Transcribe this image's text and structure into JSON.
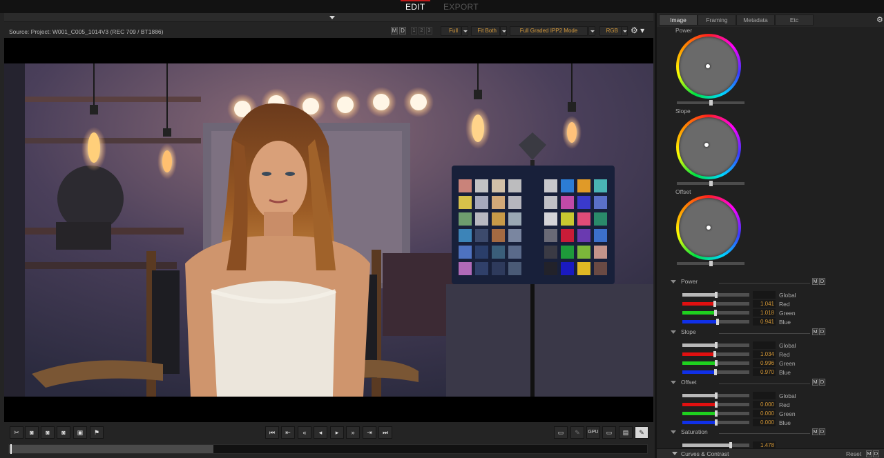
{
  "modes": {
    "edit": "EDIT",
    "export": "EXPORT"
  },
  "viewer": {
    "source_label": "Source: Project: W001_C005_1014V3     (REC 709 / BT1886)",
    "buttons": {
      "m": "M",
      "d": "D",
      "one": "1",
      "two": "2",
      "three": "3"
    },
    "dropdowns": {
      "resolution": "Full",
      "fit": "Fit Both",
      "mode": "Full Graded IPP2 Mode",
      "channel": "RGB"
    },
    "gear": "⚙"
  },
  "transport": {
    "left_tools": [
      "✂",
      "◙",
      "◙",
      "◙",
      "▣",
      "⚑"
    ],
    "playback": [
      "⏮",
      "⇤",
      "«",
      "◂",
      "▸",
      "»",
      "⇥",
      "⏭"
    ],
    "right_tools": [
      "▭",
      "✎",
      "GPU",
      "▭",
      "▤",
      "✎"
    ]
  },
  "timeline": {
    "progress": 0.32
  },
  "panel": {
    "tabs": [
      "Image",
      "Framing",
      "Metadata",
      "Etc"
    ],
    "active_tab": "Image",
    "gear": "⚙",
    "wheels": [
      {
        "label": "Power",
        "dot_x": 0.49,
        "dot_y": 0.5,
        "slider": 0.5
      },
      {
        "label": "Slope",
        "dot_x": 0.47,
        "dot_y": 0.46,
        "slider": 0.5
      },
      {
        "label": "Offset",
        "dot_x": 0.5,
        "dot_y": 0.5,
        "slider": 0.5
      }
    ],
    "sections": [
      {
        "title": "Power",
        "m": "M",
        "d": "D",
        "rows": [
          {
            "label": "Global",
            "value": "",
            "color": "#b8b8b8",
            "level": 0.5
          },
          {
            "label": "Red",
            "value": "1.041",
            "color": "#e01010",
            "level": 0.48
          },
          {
            "label": "Green",
            "value": "1.018",
            "color": "#1fd11f",
            "level": 0.49
          },
          {
            "label": "Blue",
            "value": "0.941",
            "color": "#1030e8",
            "level": 0.53
          }
        ]
      },
      {
        "title": "Slope",
        "m": "M",
        "d": "D",
        "rows": [
          {
            "label": "Global",
            "value": "",
            "color": "#b8b8b8",
            "level": 0.5
          },
          {
            "label": "Red",
            "value": "1.034",
            "color": "#e01010",
            "level": 0.48
          },
          {
            "label": "Green",
            "value": "0.996",
            "color": "#1fd11f",
            "level": 0.5
          },
          {
            "label": "Blue",
            "value": "0.970",
            "color": "#1030e8",
            "level": 0.49
          }
        ]
      },
      {
        "title": "Offset",
        "m": "M",
        "d": "D",
        "rows": [
          {
            "label": "Global",
            "value": "",
            "color": "#b8b8b8",
            "level": 0.5
          },
          {
            "label": "Red",
            "value": "0.000",
            "color": "#e01010",
            "level": 0.5
          },
          {
            "label": "Green",
            "value": "0.000",
            "color": "#1fd11f",
            "level": 0.5
          },
          {
            "label": "Blue",
            "value": "0.000",
            "color": "#1030e8",
            "level": 0.5
          }
        ]
      },
      {
        "title": "Saturation",
        "m": "M",
        "d": "D",
        "rows": [
          {
            "label": "",
            "value": "1.478",
            "color": "#b8b8b8",
            "level": 0.72
          }
        ]
      }
    ],
    "footer": {
      "title": "Curves & Contrast",
      "reset": "Reset",
      "m": "M",
      "d": "D"
    }
  }
}
